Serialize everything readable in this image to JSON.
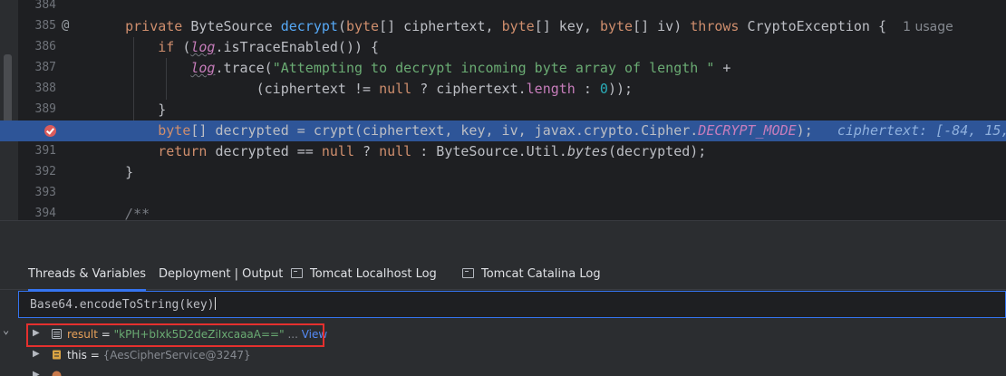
{
  "editor": {
    "lines": [
      {
        "num": "384"
      },
      {
        "num": "385",
        "usage": "1 usage"
      },
      {
        "num": "386"
      },
      {
        "num": "387"
      },
      {
        "num": "388"
      },
      {
        "num": "389"
      },
      {
        "num": "390"
      },
      {
        "num": "391"
      },
      {
        "num": "392"
      },
      {
        "num": "393"
      },
      {
        "num": "394"
      }
    ],
    "inline_debug_value": "ciphertext: [-84, 15,",
    "gutter_icons": {
      "line_385": "at-override-icon",
      "line_390": "breakpoint-icon"
    }
  },
  "tabs": [
    {
      "label": "Threads & Variables"
    },
    {
      "label": "Deployment | Output"
    },
    {
      "label": "Tomcat Localhost Log",
      "icon": "console-icon"
    },
    {
      "label": "Tomcat Catalina Log",
      "icon": "console-icon"
    }
  ],
  "evaluate": {
    "expression": "Base64.encodeToString(key)"
  },
  "variables": [
    {
      "name": "result",
      "equals": " = ",
      "value": "\"kPH+bIxk5D2deZiIxcaaaA==\"",
      "suffix": " ... ",
      "link": "View"
    },
    {
      "name": "this",
      "equals": " = ",
      "value": "{AesCipherService@3247}"
    }
  ],
  "colors": {
    "accent": "#3574f0",
    "exec_line": "#2e5598",
    "highlight_box": "#e5302e",
    "string": "#6aab73",
    "keyword": "#cf8e6d"
  }
}
